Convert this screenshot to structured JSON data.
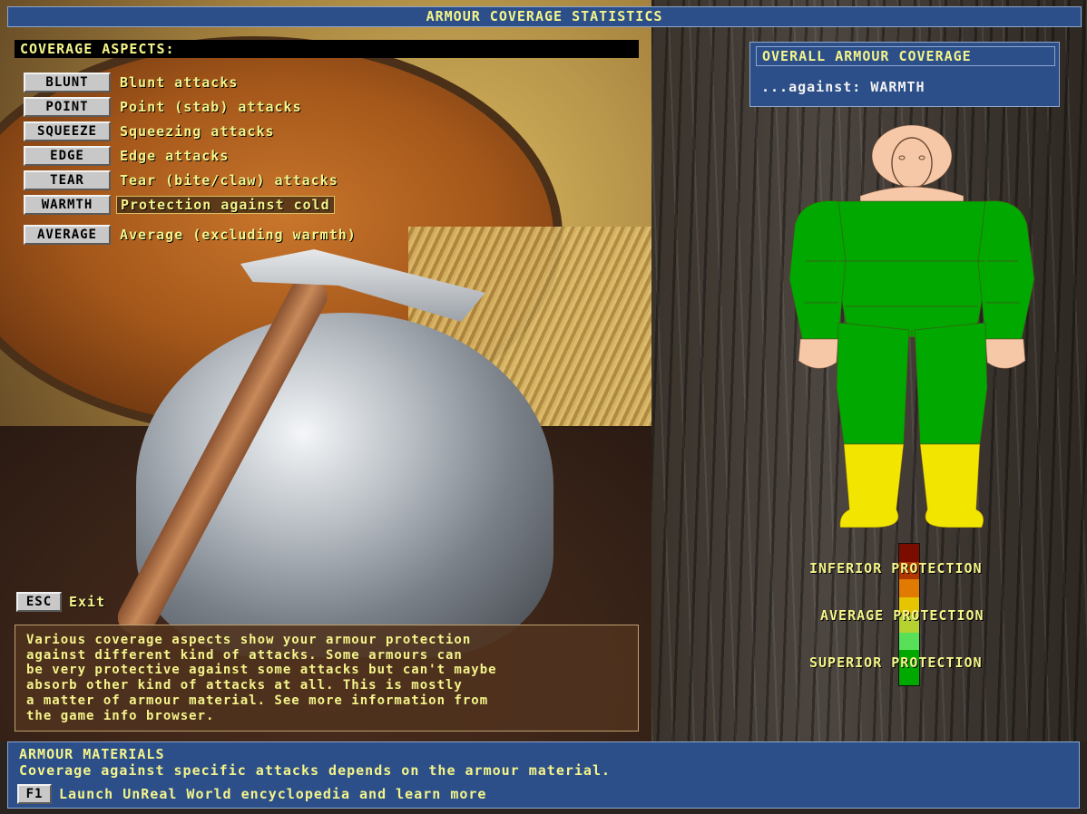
{
  "title": "ARMOUR COVERAGE STATISTICS",
  "aspects": {
    "heading": "COVERAGE ASPECTS:",
    "items": [
      {
        "key": "BLUNT",
        "label": "Blunt attacks"
      },
      {
        "key": "POINT",
        "label": "Point (stab) attacks"
      },
      {
        "key": "SQUEEZE",
        "label": "Squeezing attacks"
      },
      {
        "key": "EDGE",
        "label": "Edge attacks"
      },
      {
        "key": "TEAR",
        "label": "Tear (bite/claw) attacks"
      },
      {
        "key": "WARMTH",
        "label": "Protection against cold",
        "selected": true
      },
      {
        "key": "AVERAGE",
        "label": "Average (excluding warmth)"
      }
    ]
  },
  "exit": {
    "key": "ESC",
    "label": "Exit"
  },
  "info_lines": [
    "Various coverage aspects show your armour protection",
    "against different kind of attacks. Some armours can",
    "be very protective against some attacks but can't maybe",
    "absorb other kind of attacks at all. This is mostly",
    "a matter of armour material. See more information from",
    "the game info browser."
  ],
  "overall": {
    "heading": "OVERALL ARMOUR COVERAGE",
    "value": "...against: WARMTH"
  },
  "body_coverage": {
    "head": "#f7c8a8",
    "torso": "#00a800",
    "arms": "#00a800",
    "hands": "#f7c8a8",
    "legs": "#00a800",
    "feet": "#f2e600"
  },
  "legend": {
    "colors": [
      "#7a0c00",
      "#b03800",
      "#e07a00",
      "#e6c400",
      "#b6d230",
      "#58e058",
      "#00a800",
      "#00a800"
    ],
    "inferior": "INFERIOR PROTECTION",
    "average": "AVERAGE PROTECTION",
    "superior": "SUPERIOR PROTECTION"
  },
  "footer": {
    "heading": "ARMOUR MATERIALS",
    "text": "Coverage against specific attacks depends on the armour material.",
    "f1_key": "F1",
    "f1_label": "Launch UnReal World encyclopedia and learn more"
  }
}
